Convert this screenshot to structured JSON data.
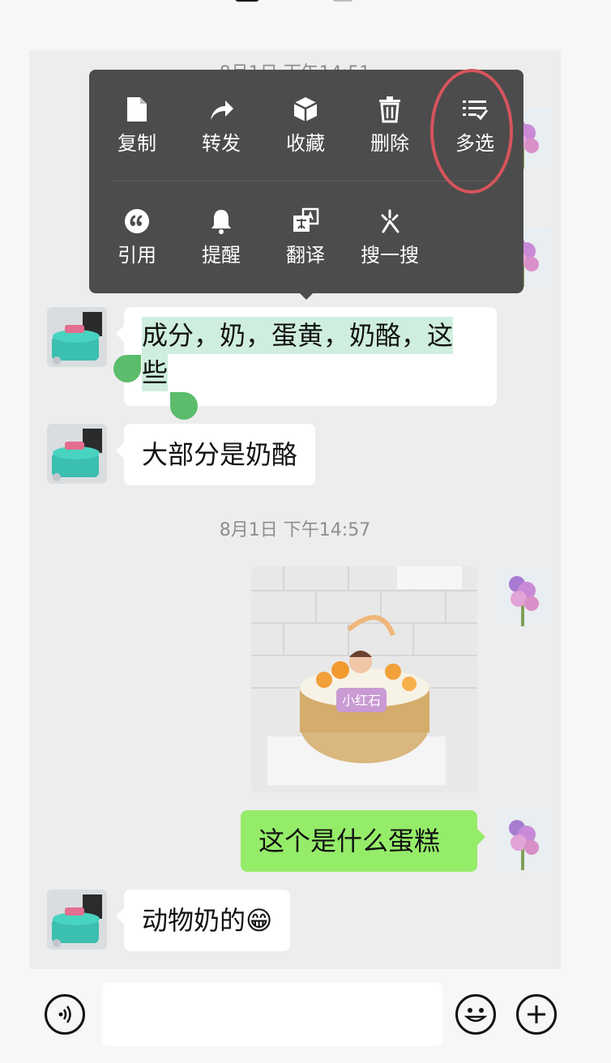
{
  "chat": {
    "timestamp_top": "8月1日 下午14:51",
    "timestamp_mid": "8月1日 下午14:57",
    "messages": {
      "selected_line1": "成分，奶，蛋黄，奶酪，这",
      "selected_line2": "些",
      "msg_mostly_cheese": "大部分是奶酪",
      "msg_question": "这个是什么蛋糕",
      "msg_animal_cream": "动物奶的😁"
    },
    "cake_photo_plaque": "小红石"
  },
  "context_menu": {
    "row1": [
      {
        "label": "复制",
        "icon": "document-icon"
      },
      {
        "label": "转发",
        "icon": "forward-arrow-icon"
      },
      {
        "label": "收藏",
        "icon": "cube-icon"
      },
      {
        "label": "删除",
        "icon": "trash-icon"
      },
      {
        "label": "多选",
        "icon": "checklist-icon"
      }
    ],
    "row2": [
      {
        "label": "引用",
        "icon": "quote-icon"
      },
      {
        "label": "提醒",
        "icon": "bell-icon"
      },
      {
        "label": "翻译",
        "icon": "translate-icon"
      },
      {
        "label": "搜一搜",
        "icon": "sparkle-icon"
      }
    ],
    "highlight_color": "#d6545c"
  },
  "input_bar": {
    "placeholder": "",
    "voice_icon": "voice-icon",
    "emoji_icon": "emoji-icon",
    "plus_icon": "plus-icon"
  },
  "colors": {
    "incoming_bubble": "#ffffff",
    "outgoing_bubble": "#95ec69",
    "selection_bg": "#cfeede",
    "selection_handle": "#5bbd6b",
    "menu_bg": "#4c4c4c",
    "chat_bg": "#ededed"
  }
}
